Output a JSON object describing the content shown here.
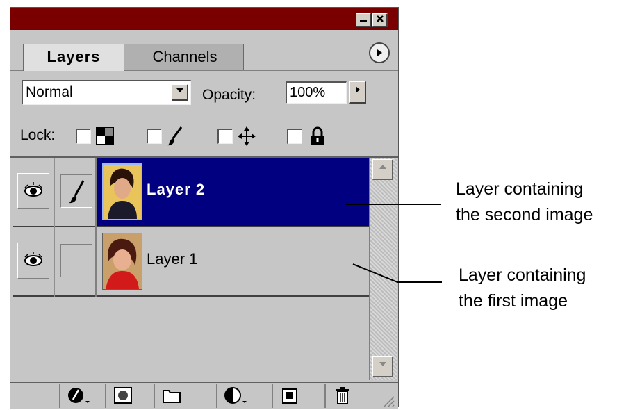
{
  "panel": {
    "tabs": [
      {
        "label": "Layers",
        "active": true
      },
      {
        "label": "Channels",
        "active": false
      }
    ],
    "blend_mode": "Normal",
    "opacity_label": "Opacity:",
    "opacity_value": "100%",
    "lock_label": "Lock:",
    "lock_options": [
      "lock-transparency-icon",
      "lock-image-icon",
      "lock-position-icon",
      "lock-all-icon"
    ],
    "layers": [
      {
        "name": "Layer 2",
        "selected": true,
        "visible": true,
        "linked_brush": true
      },
      {
        "name": "Layer 1",
        "selected": false,
        "visible": true,
        "linked_brush": false
      }
    ],
    "bottom_buttons": [
      "layer-style-icon",
      "add-mask-icon",
      "new-set-folder-icon",
      "adjustment-layer-icon",
      "new-layer-icon",
      "trash-icon"
    ],
    "colors": {
      "titlebar": "#7a0000",
      "selected_row": "#000080",
      "panel_bg": "#c6c6c6"
    }
  },
  "annotations": {
    "layer2_line1": "Layer containing",
    "layer2_line2": "the second image",
    "layer1_line1": "Layer containing",
    "layer1_line2": "the first image"
  }
}
